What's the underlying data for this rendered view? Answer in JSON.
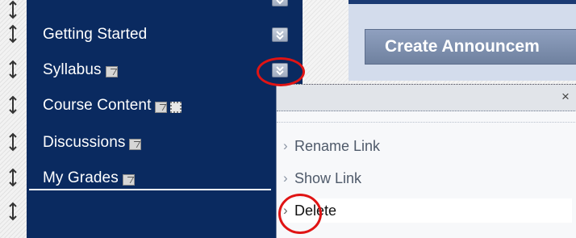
{
  "course_menu": {
    "items": [
      {
        "label": "Getting Started",
        "has_edit_icon": false,
        "has_chevron": true
      },
      {
        "label": "Syllabus",
        "has_edit_icon": true,
        "has_chevron": true
      },
      {
        "label": "Course Content",
        "has_edit_icon": true,
        "has_chevron": false
      },
      {
        "label": "Discussions",
        "has_edit_icon": true,
        "has_chevron": false
      },
      {
        "label": "My Grades",
        "has_edit_icon": true,
        "has_chevron": false
      }
    ]
  },
  "content": {
    "create_button_label": "Create Announcem"
  },
  "context_menu": {
    "close_glyph": "×",
    "items": [
      {
        "label": "Rename Link",
        "highlighted": false
      },
      {
        "label": "Show Link",
        "highlighted": false
      },
      {
        "label": "Delete",
        "highlighted": true
      }
    ]
  },
  "icons": {
    "drag_handle": "drag-handle-icon",
    "chevron": "chevron-down-icon",
    "edit": "edit-icon",
    "close": "close-icon",
    "arrow": "arrow-right-icon"
  },
  "colors": {
    "menu_bg": "#0a2a60",
    "annotation": "#e01414",
    "popup_bg": "#f7f8fa",
    "panel_bg": "#d3dcec"
  }
}
